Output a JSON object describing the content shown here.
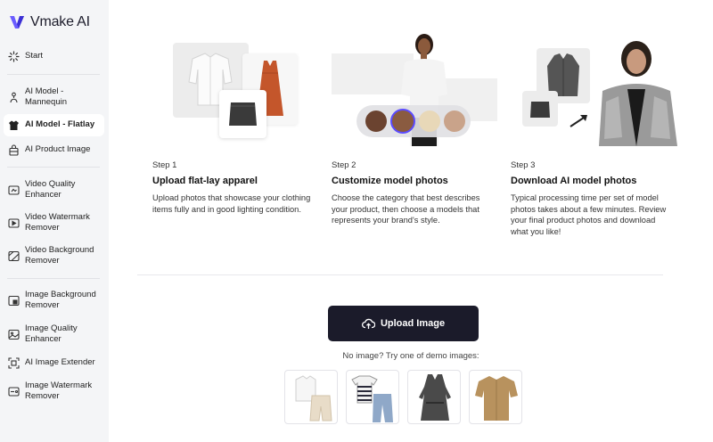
{
  "brand": {
    "name": "Vmake AI",
    "accent": "#5b4bff"
  },
  "sidebar": {
    "items": [
      {
        "label": "Start",
        "icon": "sparkle-loader-icon"
      },
      {
        "label": "AI Model - Mannequin",
        "icon": "mannequin-icon"
      },
      {
        "label": "AI Model - Flatlay",
        "icon": "hanger-icon",
        "active": true
      },
      {
        "label": "AI Product Image",
        "icon": "bag-icon"
      },
      {
        "label": "Video Quality Enhancer",
        "icon": "video-enhance-icon"
      },
      {
        "label": "Video Watermark Remover",
        "icon": "video-watermark-icon"
      },
      {
        "label": "Video Background Remover",
        "icon": "video-background-icon"
      },
      {
        "label": "Image Background Remover",
        "icon": "image-background-icon"
      },
      {
        "label": "Image Quality Enhancer",
        "icon": "image-enhance-icon"
      },
      {
        "label": "AI Image Extender",
        "icon": "extend-icon"
      },
      {
        "label": "Image Watermark Remover",
        "icon": "image-watermark-icon"
      }
    ]
  },
  "steps": [
    {
      "label": "Step 1",
      "title": "Upload flat-lay apparel",
      "desc": "Upload photos that showcase your clothing items fully and in good lighting condition."
    },
    {
      "label": "Step 2",
      "title": "Customize model photos",
      "desc": "Choose the category that best describes your product, then choose a models that represents your brand's style."
    },
    {
      "label": "Step 3",
      "title": "Download AI model photos",
      "desc": "Typical processing time per set of model photos takes about a few minutes. Review your final product photos and download what you like!"
    }
  ],
  "upload": {
    "label": "Upload Image",
    "icon": "cloud-upload-icon"
  },
  "demo": {
    "prompt": "No image? Try one of demo images:",
    "items": [
      "white-shirt-shorts",
      "striped-tee-jeans",
      "grey-dress",
      "tan-shirt"
    ]
  }
}
